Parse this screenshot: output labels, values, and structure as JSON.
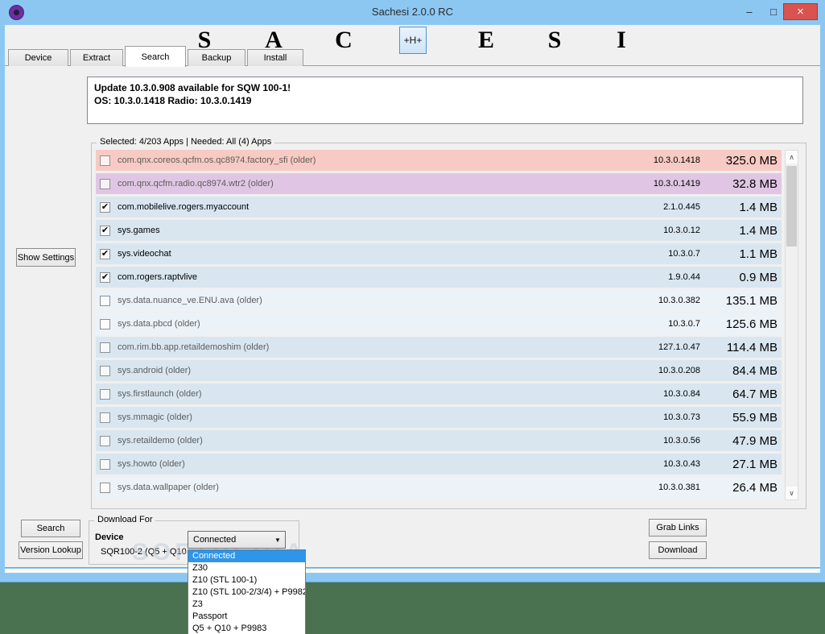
{
  "window": {
    "title": "Sachesi 2.0.0 RC",
    "controls": {
      "minimize": "–",
      "maximize": "□",
      "close": "×"
    }
  },
  "header": {
    "letters": [
      "S",
      "A",
      "C",
      "E",
      "S",
      "I"
    ],
    "h_button_label": "+H+"
  },
  "tabs": [
    {
      "label": "Device",
      "active": false
    },
    {
      "label": "Extract",
      "active": false
    },
    {
      "label": "Search",
      "active": true
    },
    {
      "label": "Backup",
      "active": false
    },
    {
      "label": "Install",
      "active": false
    }
  ],
  "update_box": {
    "line1": "Update 10.3.0.908 available for SQW 100-1!",
    "line2": "OS: 10.3.0.1418 Radio: 10.3.0.1419"
  },
  "apps_group": {
    "title": "Selected: 4/203 Apps | Needed: All (4) Apps",
    "rows": [
      {
        "name": "com.qnx.coreos.qcfm.os.qc8974.factory_sfi (older)",
        "checked": false,
        "version": "10.3.0.1418",
        "size": "325.0 MB",
        "shade": "pink"
      },
      {
        "name": "com.qnx.qcfm.radio.qc8974.wtr2 (older)",
        "checked": false,
        "version": "10.3.0.1419",
        "size": "32.8 MB",
        "shade": "lavender"
      },
      {
        "name": "com.mobilelive.rogers.myaccount",
        "checked": true,
        "version": "2.1.0.445",
        "size": "1.4 MB",
        "shade": "blue"
      },
      {
        "name": "sys.games",
        "checked": true,
        "version": "10.3.0.12",
        "size": "1.4 MB",
        "shade": "blue"
      },
      {
        "name": "sys.videochat",
        "checked": true,
        "version": "10.3.0.7",
        "size": "1.1 MB",
        "shade": "blue"
      },
      {
        "name": "com.rogers.raptvlive",
        "checked": true,
        "version": "1.9.0.44",
        "size": "0.9 MB",
        "shade": "blue"
      },
      {
        "name": "sys.data.nuance_ve.ENU.ava (older)",
        "checked": false,
        "version": "10.3.0.382",
        "size": "135.1 MB",
        "shade": "light"
      },
      {
        "name": "sys.data.pbcd (older)",
        "checked": false,
        "version": "10.3.0.7",
        "size": "125.6 MB",
        "shade": "light"
      },
      {
        "name": "com.rim.bb.app.retaildemoshim (older)",
        "checked": false,
        "version": "127.1.0.47",
        "size": "114.4 MB",
        "shade": "blue"
      },
      {
        "name": "sys.android (older)",
        "checked": false,
        "version": "10.3.0.208",
        "size": "84.4 MB",
        "shade": "blue"
      },
      {
        "name": "sys.firstlaunch (older)",
        "checked": false,
        "version": "10.3.0.84",
        "size": "64.7 MB",
        "shade": "blue"
      },
      {
        "name": "sys.mmagic (older)",
        "checked": false,
        "version": "10.3.0.73",
        "size": "55.9 MB",
        "shade": "blue"
      },
      {
        "name": "sys.retaildemo (older)",
        "checked": false,
        "version": "10.3.0.56",
        "size": "47.9 MB",
        "shade": "blue"
      },
      {
        "name": "sys.howto (older)",
        "checked": false,
        "version": "10.3.0.43",
        "size": "27.1 MB",
        "shade": "blue"
      },
      {
        "name": "sys.data.wallpaper (older)",
        "checked": false,
        "version": "10.3.0.381",
        "size": "26.4 MB",
        "shade": "light"
      }
    ]
  },
  "left_panel": {
    "show_settings": "Show Settings"
  },
  "bottom": {
    "search": "Search",
    "version_lookup": "Version Lookup",
    "grab_links": "Grab Links",
    "download": "Download",
    "download_for": {
      "title": "Download For",
      "device_label": "Device",
      "device_value": "SQR100-2 (Q5 + Q10"
    },
    "combo": {
      "value": "Connected",
      "selected_index": 0,
      "options": [
        "Connected",
        "Z30",
        "Z10 (STL 100-1)",
        "Z10 (STL 100-2/3/4) + P9982",
        "Z3",
        "Passport",
        "Q5 + Q10 + P9983"
      ]
    }
  },
  "watermark": "SOFTPEDIA",
  "icons": {
    "check": "✔",
    "scroll_up": "∧",
    "scroll_down": "∨",
    "combo_arrow": "▼"
  },
  "colors": {
    "titlebar": "#8cc7f2",
    "desktop": "#4a7150",
    "close_button": "#d9534f",
    "row_pink": "#f8cac4",
    "row_lavender": "#e0c6e4",
    "row_blue": "#d9e6f0",
    "row_light": "#ecf3f8",
    "selection_blue": "#2e95ea"
  }
}
